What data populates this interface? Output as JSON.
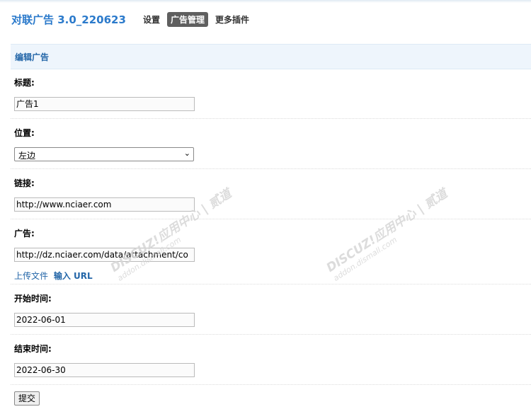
{
  "header": {
    "plugin_title": "对联广告 3.0_220623",
    "tabs": [
      {
        "label": "设置",
        "active": false
      },
      {
        "label": "广告管理",
        "active": true
      },
      {
        "label": "更多插件",
        "active": false
      }
    ]
  },
  "section": {
    "title": "编辑广告"
  },
  "form": {
    "title_label": "标题:",
    "title_value": "广告1",
    "position_label": "位置:",
    "position_value": "左边",
    "link_label": "链接:",
    "link_value": "http://www.nciaer.com",
    "ad_label": "广告:",
    "ad_value": "http://dz.nciaer.com/data/attachment/co",
    "upload_link": "上传文件",
    "input_url_link": "输入 URL",
    "start_label": "开始时间:",
    "start_value": "2022-06-01",
    "end_label": "结束时间:",
    "end_value": "2022-06-30",
    "submit_label": "提交"
  },
  "watermark": {
    "brand": "DISCUZ!应用中心 | 贰道",
    "domain": "addon.dismall.com"
  },
  "colors": {
    "accent": "#2b7acb",
    "section_bg": "#eef5fc",
    "active_tab": "#5f5f5f"
  }
}
